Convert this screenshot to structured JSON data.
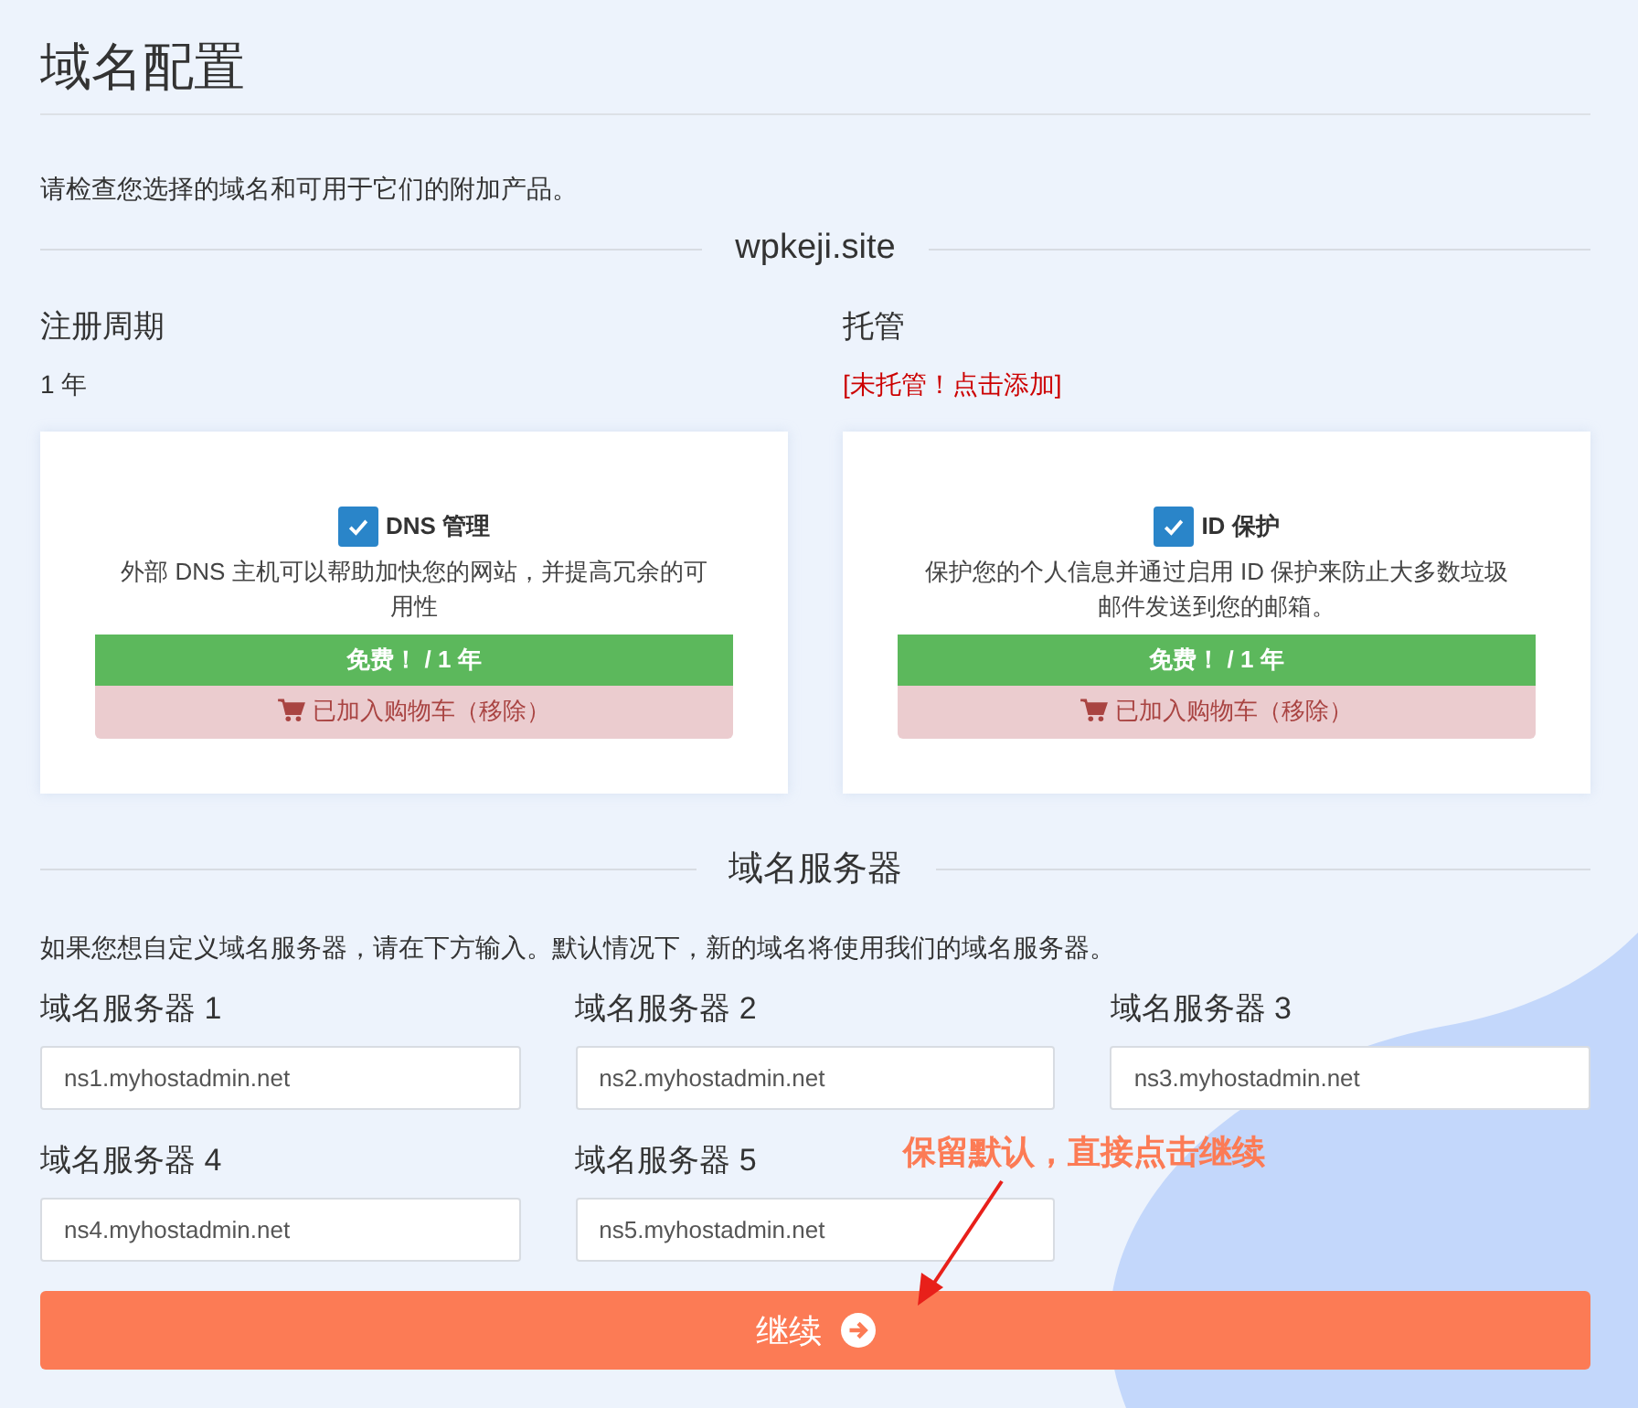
{
  "page": {
    "title": "域名配置",
    "description": "请检查您选择的域名和可用于它们的附加产品。"
  },
  "domain": "wpkeji.site",
  "registration": {
    "label": "注册周期",
    "value": "1 年"
  },
  "hosting": {
    "label": "托管",
    "value": "[未托管！点击添加]"
  },
  "addons": [
    {
      "title": "DNS 管理",
      "checked": true,
      "description": "外部 DNS 主机可以帮助加快您的网站，并提高冗余的可用性",
      "price": "免费！ / 1 年",
      "cart": "已加入购物车（移除）"
    },
    {
      "title": "ID 保护",
      "checked": true,
      "description": "保护您的个人信息并通过启用 ID 保护来防止大多数垃圾邮件发送到您的邮箱。",
      "price": "免费！ / 1 年",
      "cart": "已加入购物车（移除）"
    }
  ],
  "nameservers": {
    "heading": "域名服务器",
    "description": "如果您想自定义域名服务器，请在下方输入。默认情况下，新的域名将使用我们的域名服务器。",
    "fields": [
      {
        "label": "域名服务器 1",
        "value": "ns1.myhostadmin.net"
      },
      {
        "label": "域名服务器 2",
        "value": "ns2.myhostadmin.net"
      },
      {
        "label": "域名服务器 3",
        "value": "ns3.myhostadmin.net"
      },
      {
        "label": "域名服务器 4",
        "value": "ns4.myhostadmin.net"
      },
      {
        "label": "域名服务器 5",
        "value": "ns5.myhostadmin.net"
      }
    ]
  },
  "continue_button": "继续",
  "annotation": "保留默认，直接点击继续"
}
